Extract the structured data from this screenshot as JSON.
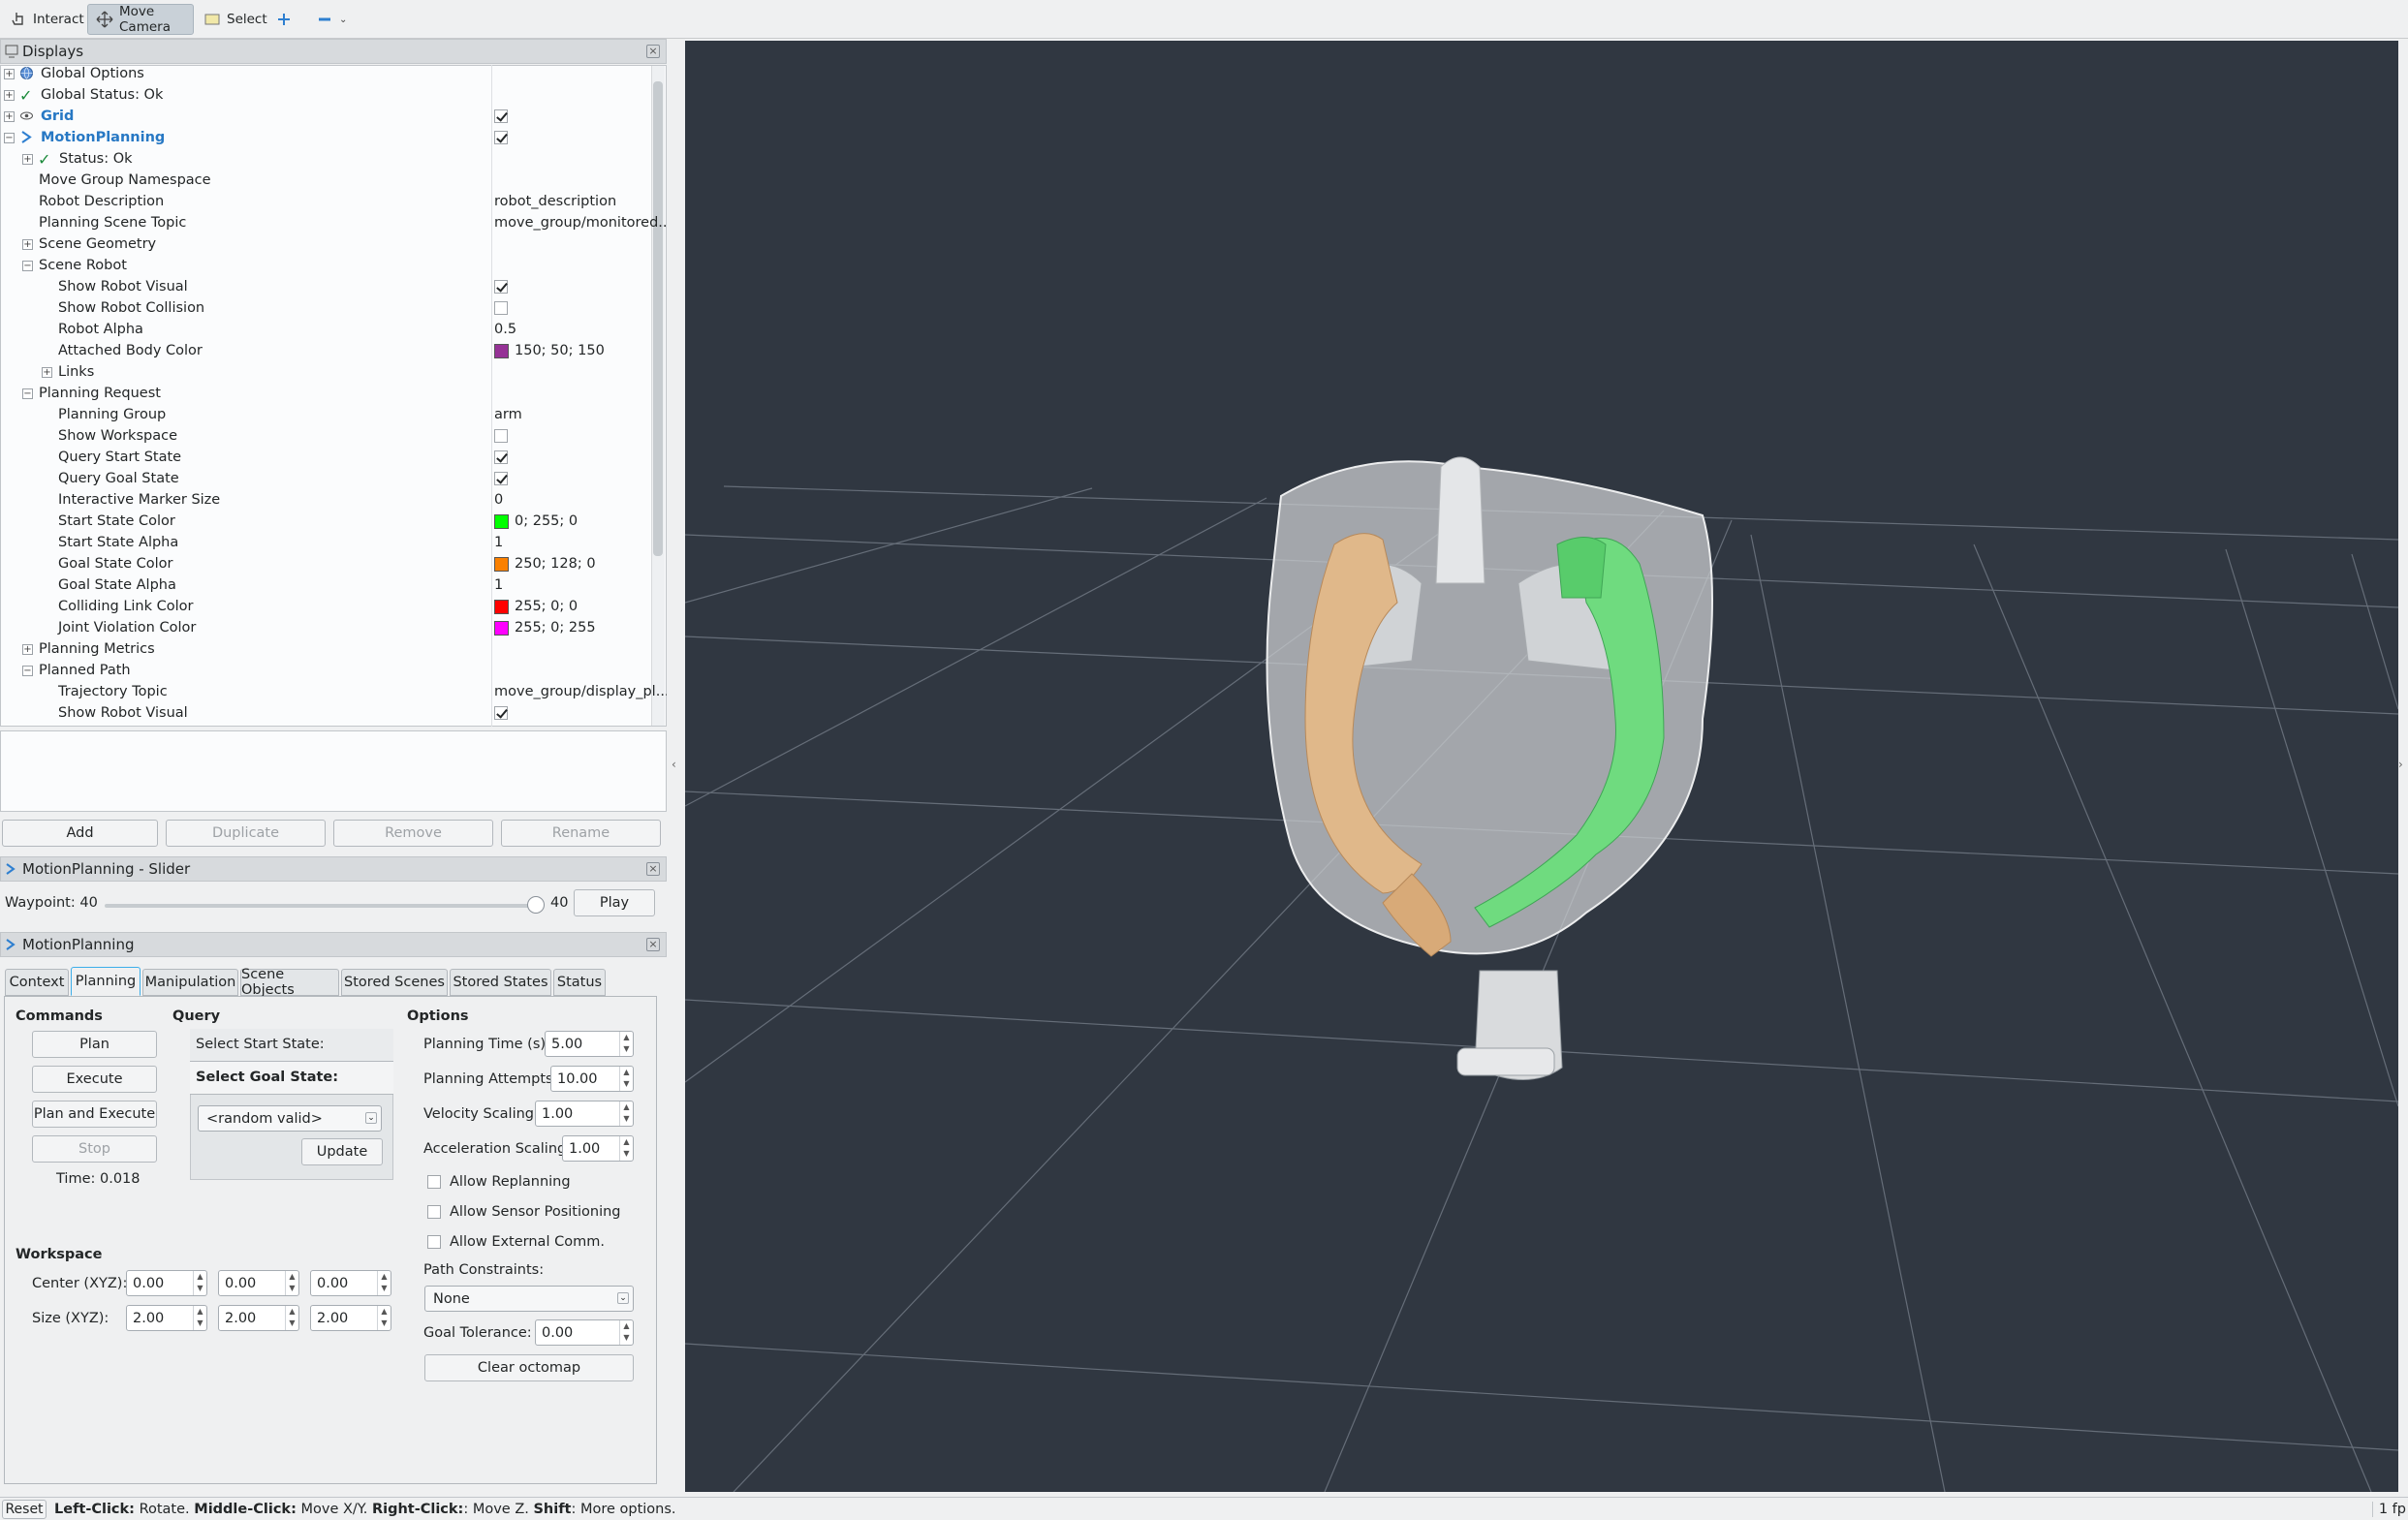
{
  "toolbar": {
    "interact": "Interact",
    "move_camera": "Move Camera",
    "select": "Select"
  },
  "displays": {
    "title": "Displays",
    "rows": [
      {
        "label": "Global Options",
        "value": ""
      },
      {
        "label": "Global Status: Ok",
        "value": ""
      },
      {
        "label": "Grid",
        "value": ""
      },
      {
        "label": "MotionPlanning",
        "value": ""
      },
      {
        "label": "Status: Ok",
        "value": ""
      },
      {
        "label": "Move Group Namespace",
        "value": ""
      },
      {
        "label": "Robot Description",
        "value": "robot_description"
      },
      {
        "label": "Planning Scene Topic",
        "value": "move_group/monitored..."
      },
      {
        "label": "Scene Geometry",
        "value": ""
      },
      {
        "label": "Scene Robot",
        "value": ""
      },
      {
        "label": "Show Robot Visual",
        "value": ""
      },
      {
        "label": "Show Robot Collision",
        "value": ""
      },
      {
        "label": "Robot Alpha",
        "value": "0.5"
      },
      {
        "label": "Attached Body Color",
        "value": "150; 50; 150"
      },
      {
        "label": "Links",
        "value": ""
      },
      {
        "label": "Planning Request",
        "value": ""
      },
      {
        "label": "Planning Group",
        "value": "arm"
      },
      {
        "label": "Show Workspace",
        "value": ""
      },
      {
        "label": "Query Start State",
        "value": ""
      },
      {
        "label": "Query Goal State",
        "value": ""
      },
      {
        "label": "Interactive Marker Size",
        "value": "0"
      },
      {
        "label": "Start State Color",
        "value": "0; 255; 0"
      },
      {
        "label": "Start State Alpha",
        "value": "1"
      },
      {
        "label": "Goal State Color",
        "value": "250; 128; 0"
      },
      {
        "label": "Goal State Alpha",
        "value": "1"
      },
      {
        "label": "Colliding Link Color",
        "value": "255; 0; 0"
      },
      {
        "label": "Joint Violation Color",
        "value": "255; 0; 255"
      },
      {
        "label": "Planning Metrics",
        "value": ""
      },
      {
        "label": "Planned Path",
        "value": ""
      },
      {
        "label": "Trajectory Topic",
        "value": "move_group/display_pl..."
      },
      {
        "label": "Show Robot Visual",
        "value": ""
      }
    ],
    "buttons": {
      "add": "Add",
      "duplicate": "Duplicate",
      "remove": "Remove",
      "rename": "Rename"
    }
  },
  "slider_panel": {
    "title": "MotionPlanning - Slider",
    "waypoint_label": "Waypoint: 40",
    "waypoint_value": "40",
    "waypoint_fraction": 1.0,
    "play": "Play"
  },
  "mp_panel": {
    "title": "MotionPlanning",
    "tabs": [
      "Context",
      "Planning",
      "Manipulation",
      "Scene Objects",
      "Stored Scenes",
      "Stored States",
      "Status"
    ],
    "commands": {
      "title": "Commands",
      "plan": "Plan",
      "execute": "Execute",
      "plan_and_execute": "Plan and Execute",
      "stop": "Stop",
      "time": "Time: 0.018"
    },
    "query": {
      "title": "Query",
      "select_start": "Select Start State:",
      "select_goal": "Select Goal State:",
      "goal_option": "<random valid>",
      "update": "Update"
    },
    "options": {
      "title": "Options",
      "planning_time_label": "Planning Time (s):",
      "planning_time": "5.00",
      "planning_attempts_label": "Planning Attempts:",
      "planning_attempts": "10.00",
      "velocity_label": "Velocity Scaling:",
      "velocity": "1.00",
      "accel_label": "Acceleration Scaling:",
      "accel": "1.00",
      "allow_replanning": "Allow Replanning",
      "allow_sensor": "Allow Sensor Positioning",
      "allow_external": "Allow External Comm.",
      "path_constraints_label": "Path Constraints:",
      "path_constraints": "None",
      "goal_tolerance_label": "Goal Tolerance:",
      "goal_tolerance": "0.00",
      "clear_octomap": "Clear octomap"
    },
    "workspace": {
      "title": "Workspace",
      "center_label": "Center (XYZ):",
      "center": [
        "0.00",
        "0.00",
        "0.00"
      ],
      "size_label": "Size (XYZ):",
      "size": [
        "2.00",
        "2.00",
        "2.00"
      ]
    }
  },
  "status_bar": {
    "reset": "Reset",
    "left_click": "Left-Click:",
    "left_click_desc": "Rotate.",
    "middle_click": "Middle-Click:",
    "middle_click_desc": "Move X/Y.",
    "right_click": "Right-Click:",
    "right_click_desc": ": Move Z.",
    "shift": "Shift",
    "shift_desc": ": More options.",
    "fps": "1 fp"
  },
  "colors": {
    "attached_body": "#963296",
    "start_state": "#00ff00",
    "goal_state": "#fa8000",
    "colliding_link": "#ff0000",
    "joint_violation": "#ff00ff",
    "viewport_bg": "#303741",
    "accent": "#3daee9"
  }
}
